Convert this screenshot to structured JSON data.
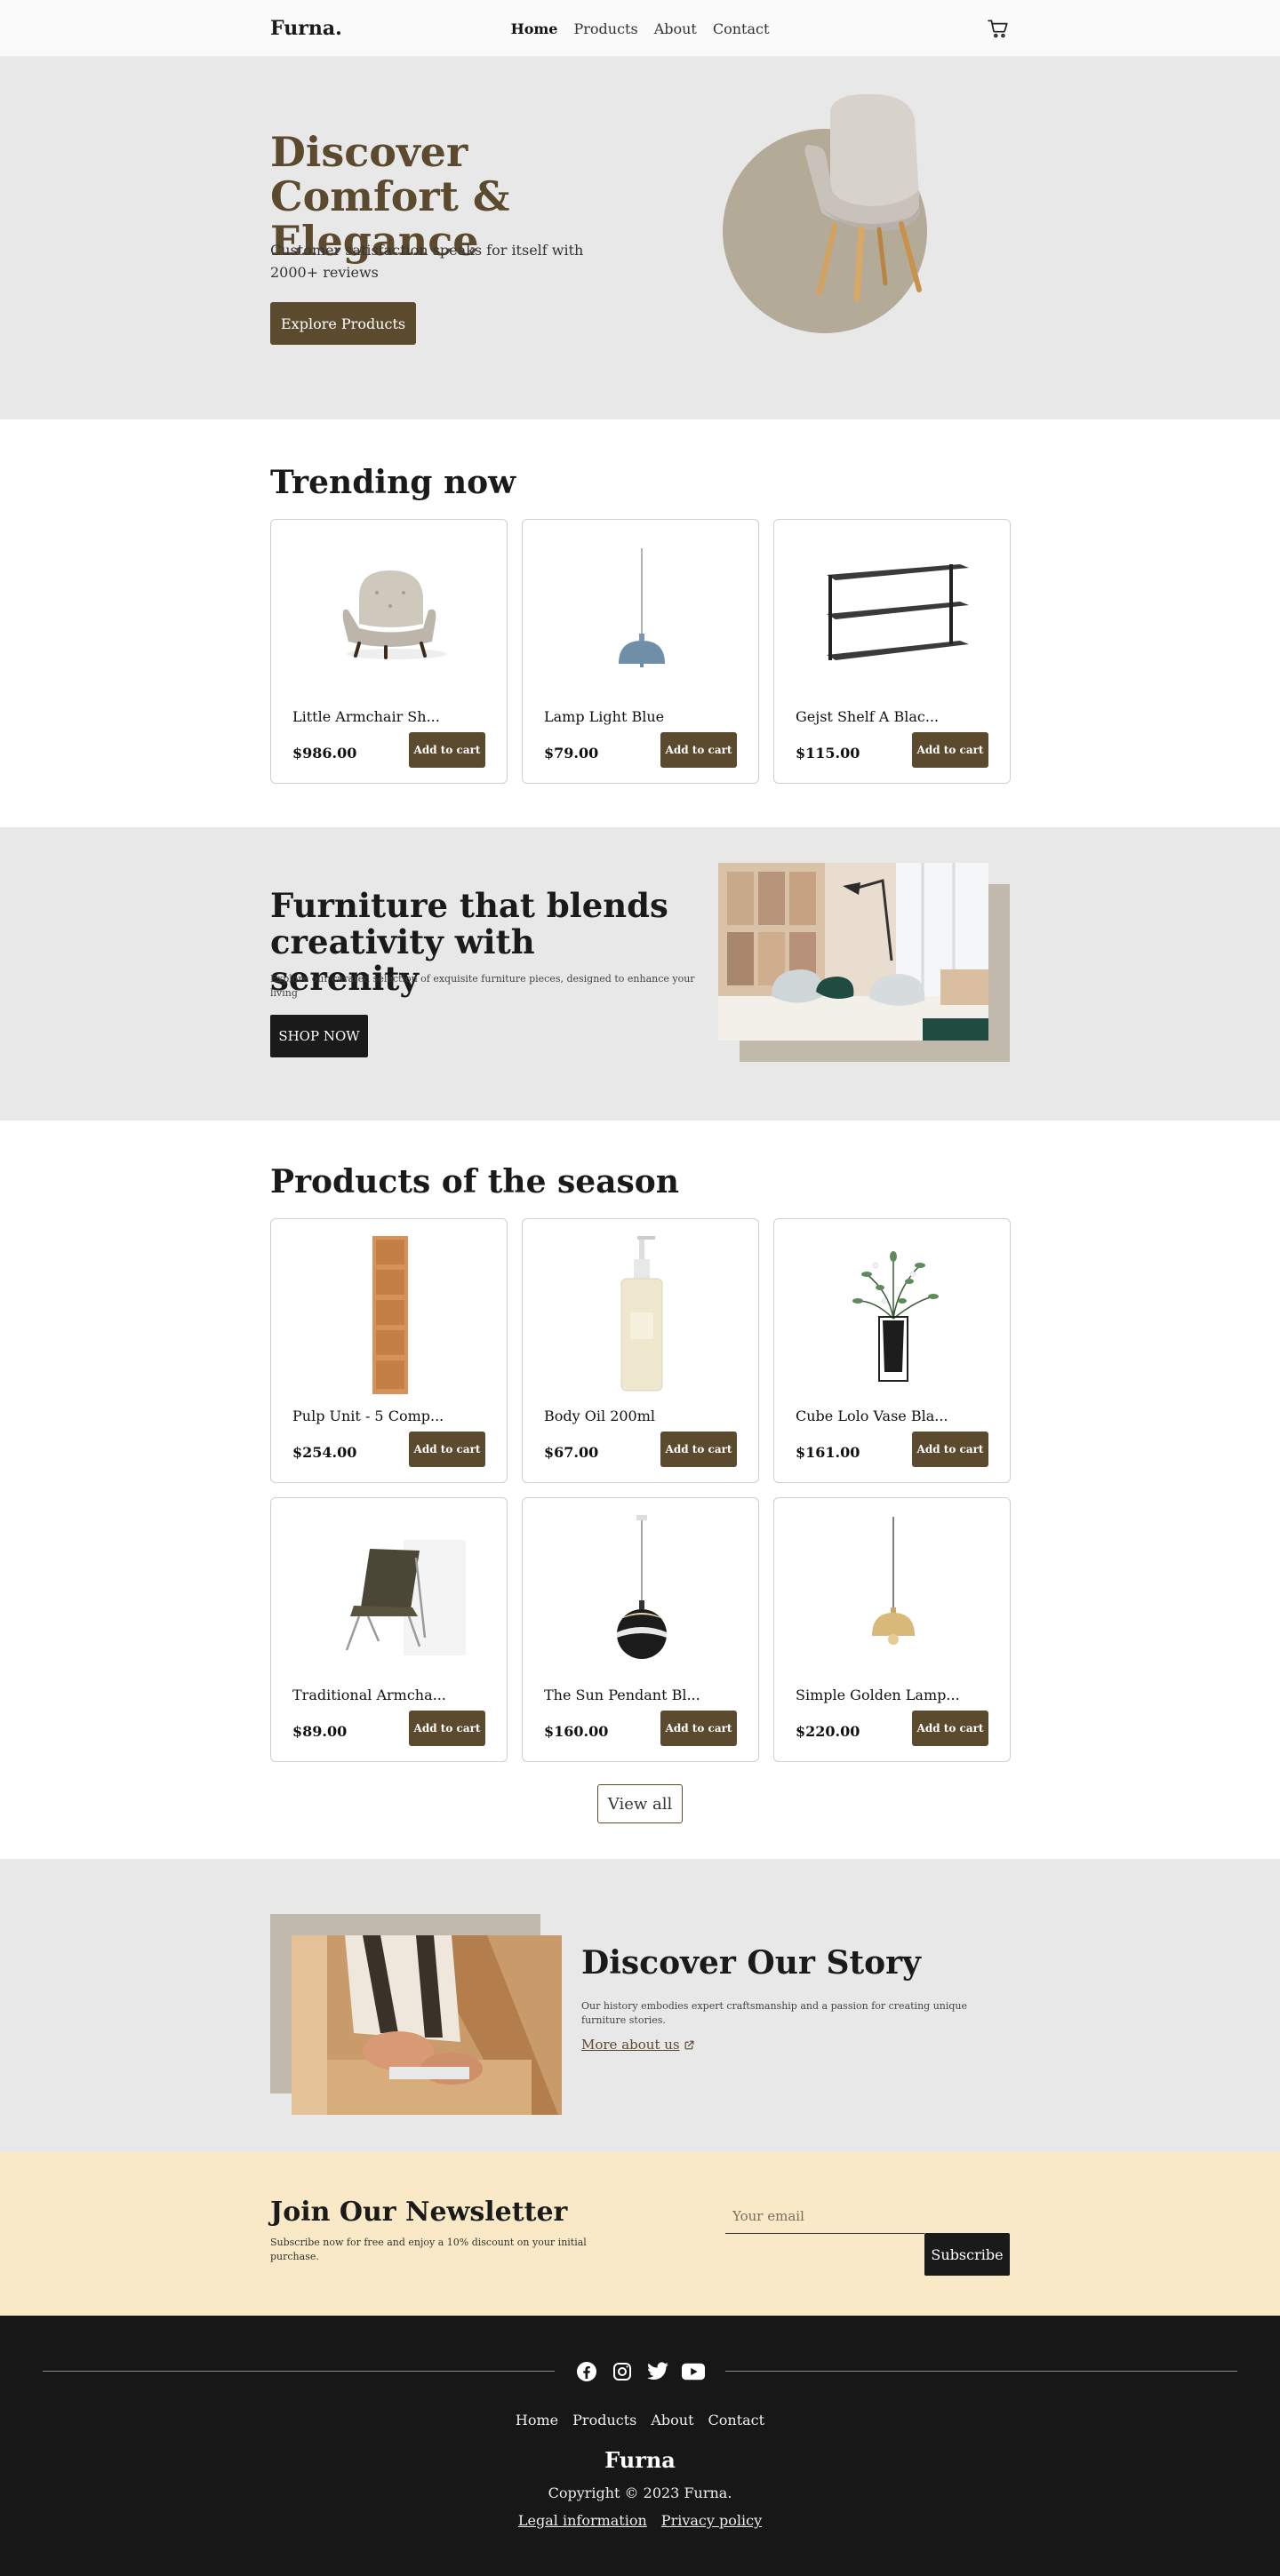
{
  "nav": {
    "logo": "Furna.",
    "links": [
      "Home",
      "Products",
      "About",
      "Contact"
    ],
    "active": "Home",
    "cart_icon": "cart-icon"
  },
  "hero": {
    "title": "Discover Comfort & Elegance",
    "subtitle": "Customer satisfaction speaks for itself with 2000+ reviews",
    "button": "Explore Products",
    "image_icon": "armchair-image"
  },
  "trending": {
    "title": "Trending now",
    "products": [
      {
        "name": "Little Armchair Sh...",
        "price": "$986.00",
        "button": "Add to cart",
        "image": "armchair-image"
      },
      {
        "name": "Lamp Light Blue",
        "price": "$79.00",
        "button": "Add to cart",
        "image": "pendant-lamp-image"
      },
      {
        "name": "Gejst Shelf A Blac...",
        "price": "$115.00",
        "button": "Add to cart",
        "image": "shelf-image"
      }
    ]
  },
  "blend": {
    "title": "Furniture that blends creativity with serenity",
    "subtitle": "Explore our curated selection of exquisite furniture pieces, designed to enhance your living",
    "button": "SHOP NOW"
  },
  "season": {
    "title": "Products of the season",
    "products": [
      {
        "name": "Pulp Unit - 5 Comp...",
        "price": "$254.00",
        "button": "Add to cart",
        "image": "bookcase-image"
      },
      {
        "name": "Body Oil 200ml",
        "price": "$67.00",
        "button": "Add to cart",
        "image": "bottle-image"
      },
      {
        "name": "Cube Lolo Vase Bla...",
        "price": "$161.00",
        "button": "Add to cart",
        "image": "vase-image"
      },
      {
        "name": "Traditional Armcha...",
        "price": "$89.00",
        "button": "Add to cart",
        "image": "lounge-chair-image"
      },
      {
        "name": "The Sun Pendant Bl...",
        "price": "$160.00",
        "button": "Add to cart",
        "image": "sphere-pendant-image"
      },
      {
        "name": "Simple Golden Lamp...",
        "price": "$220.00",
        "button": "Add to cart",
        "image": "golden-lamp-image"
      }
    ],
    "view_all": "View all"
  },
  "story": {
    "title": "Discover Our Story",
    "subtitle": "Our history embodies expert craftsmanship and a passion for creating unique furniture stories.",
    "link": "More about us"
  },
  "newsletter": {
    "title": "Join Our Newsletter",
    "subtitle": "Subscribe now for free and enjoy a 10% discount on your initial purchase.",
    "placeholder": "Your email",
    "button": "Subscribe"
  },
  "footer": {
    "socials": [
      "facebook-icon",
      "instagram-icon",
      "twitter-icon",
      "youtube-icon"
    ],
    "links": [
      "Home",
      "Products",
      "About",
      "Contact"
    ],
    "logo": "Furna",
    "copyright": "Copyright © 2023 Furna.",
    "legal": [
      "Legal information",
      "Privacy policy"
    ]
  },
  "colors": {
    "brand_brown": "#5c4a2e",
    "hero_bg": "#e8e8e8",
    "newsletter_bg": "#f9e9c7",
    "footer_bg": "#171717"
  }
}
